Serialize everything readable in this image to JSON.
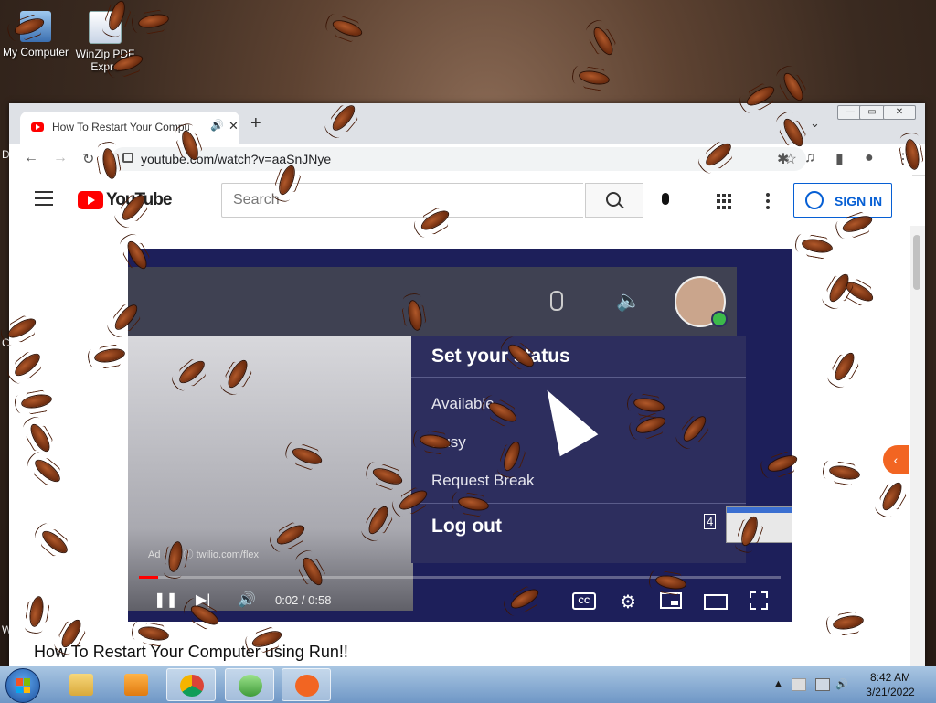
{
  "desktop": {
    "icons": [
      {
        "label": "My Computer"
      },
      {
        "label": "WinZip PDF Expre"
      }
    ],
    "side_letters": [
      "D",
      "C",
      "W"
    ]
  },
  "browser": {
    "tab": {
      "title": "How To Restart Your Compu",
      "close": "✕",
      "audio": "🔊"
    },
    "new_tab": "+",
    "controls": {
      "minimize": "—",
      "restore": "▭",
      "close": "✕"
    },
    "tab_search": "⌄",
    "nav": {
      "back": "←",
      "forward": "→",
      "reload": "↻"
    },
    "url": "youtube.com/watch?v=aaSnJNye",
    "bookmark": "☆",
    "ext": {
      "puzzle": "✱",
      "media": "♫",
      "sidebar": "▮",
      "profile": "●",
      "menu": "⋮"
    }
  },
  "youtube": {
    "logo_text": "YouTube",
    "search_placeholder": "Search",
    "sign_in": "SIGN IN",
    "video_title": "How To Restart Your Computer using Run!!"
  },
  "video_frame": {
    "menu_header": "Set your status",
    "options": [
      "Available",
      "Busy",
      "Request Break"
    ],
    "logout": "Log out",
    "pip_number": "4",
    "ad_text": "Ad · 56 ⓘ twilio.com/flex"
  },
  "player": {
    "time_current": "0:02",
    "time_total": "0:58",
    "time_display": "0:02 / 0:58",
    "progress_fraction": 0.03,
    "cc_label": "CC",
    "gear": "⚙",
    "pause": "❚❚",
    "next": "▶|",
    "volume": "🔊"
  },
  "taskbar": {
    "clock_time": "8:42 AM",
    "clock_date": "3/21/2022",
    "tray_up": "▲"
  },
  "side_tab_arrow": "‹",
  "colors": {
    "youtube_red": "#ff0000",
    "signin_blue": "#065fd4",
    "taskbar": "#8db3da",
    "side_tab": "#f26522"
  }
}
